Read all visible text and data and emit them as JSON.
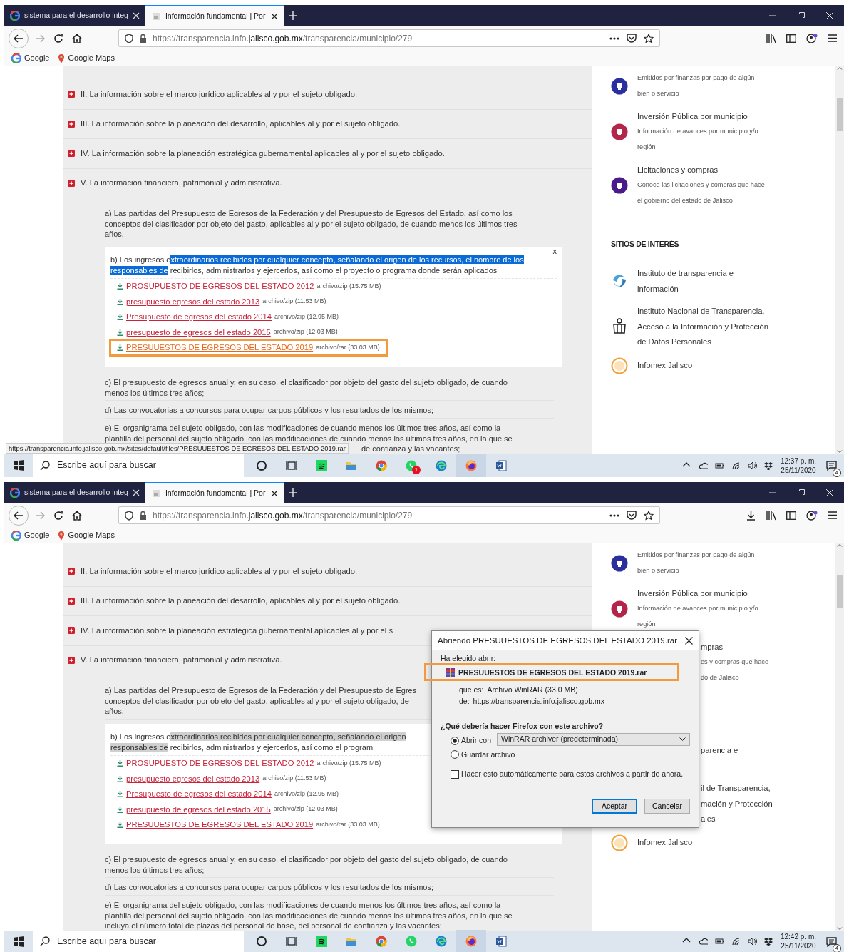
{
  "screens": [
    {
      "tabs": [
        {
          "label": "sistema para el desarrollo integ",
          "selected": false,
          "kind": "google"
        },
        {
          "label": "Información fundamental | Por",
          "selected": true,
          "kind": "site"
        }
      ],
      "url": [
        {
          "text": "https://transparencia.info.",
          "emphasized": false
        },
        {
          "text": "jalisco.gob.mx",
          "emphasized": true
        },
        {
          "text": "/transparencia/municipio/279",
          "emphasized": false
        }
      ],
      "toolbar": [
        {
          "kind": "library"
        },
        {
          "kind": "sidebar"
        },
        {
          "kind": "account"
        },
        {
          "kind": "menu"
        }
      ],
      "bookmarks": [
        {
          "label": "Google",
          "kind": "google"
        },
        {
          "label": "Google Maps",
          "kind": "pin"
        }
      ],
      "sections": [
        "II. La información sobre el marco jurídico aplicables al y por el sujeto obligado.",
        "III. La información sobre la planeación del desarrollo, aplicables al y por el sujeto obligado.",
        "IV. La información sobre la planeación estratégica gubernamental aplicables al y por el sujeto obligado.",
        "V. La información financiera, patrimonial y administrativa."
      ],
      "subsections": [
        {
          "kind": "text",
          "lines": [
            "a) Las partidas del Presupuesto de Egresos de la Federación y del Presupuesto de Egresos del Estado, así como los",
            "conceptos del clasificador por objeto del gasto, aplicables al y por el sujeto obligado, de cuando menos los últimos tres",
            "años."
          ]
        },
        {
          "kind": "files",
          "close": "x",
          "lines": [
            [
              {
                "text": "b) Los ingresos e",
                "selected": false
              },
              {
                "text": "xtraordinarios recibidos por cualquier concepto, señalando el origen de los recursos, el nombre de los",
                "selected": true
              }
            ],
            [
              {
                "text": "responsables de",
                "selected": true
              },
              {
                "text": " recibirlos, administrarlos y ejercerlos, así como el proyecto o programa donde serán aplicados",
                "selected": false
              }
            ]
          ],
          "files": [
            {
              "name": "PROSUPUESTO DE EGRESOS DEL ESTADO 2012",
              "meta": "archivo/zip (15.75 MB)",
              "highlighted": false
            },
            {
              "name": "presupuesto egresos del estado 2013",
              "meta": "archivo/zip (11.53 MB)",
              "highlighted": false
            },
            {
              "name": "Presupuesto de egresos del estado 2014",
              "meta": "archivo/zip (12.95 MB)",
              "highlighted": false
            },
            {
              "name": "presupuesto de egresos del estado 2015",
              "meta": "archivo/zip (12.03 MB)",
              "highlighted": false
            },
            {
              "name": "PRESUUESTOS DE EGRESOS DEL ESTADO 2019",
              "meta": "archivo/rar (33.03 MB)",
              "highlighted": true
            }
          ]
        },
        {
          "kind": "text",
          "lines": [
            "c) El presupuesto de egresos anual y, en su caso, el clasificador por objeto del gasto del sujeto obligado, de cuando",
            "menos los últimos tres años;"
          ]
        },
        {
          "kind": "text",
          "lines": [
            "d) Las convocatorias a concursos para ocupar cargos públicos y los resultados de los mismos;"
          ]
        },
        {
          "kind": "text",
          "status_covered": true,
          "lines": [
            "e) El organigrama del sujeto obligado, con las modificaciones de cuando menos los últimos tres años, así como la",
            "plantilla del personal del sujeto obligado, con las modificaciones de cuando menos los últimos tres años, en la que se",
            "de confianza y las vacantes;"
          ]
        }
      ],
      "sidebar_items": [
        {
          "desc": [
            "Emitidos por finanzas por pago de algún",
            "bien o servicio"
          ],
          "color": "#2b2f9e"
        },
        {
          "title": "Inversión Pública por municipio",
          "desc": [
            "Información de avances por municipio y/o",
            "región"
          ],
          "color": "#b3264a"
        },
        {
          "title": "Licitaciones y compras",
          "desc": [
            "Conoce las licitaciones y compras que hace",
            "el gobierno del estado de Jalisco"
          ],
          "color": "#4a1a8c"
        }
      ],
      "sites_heading": "SITIOS DE INTERÉS",
      "sites": [
        {
          "kind": "swirl",
          "lines": [
            "Instituto de transparencia e",
            "información"
          ]
        },
        {
          "kind": "reader",
          "lines": [
            "Instituto Nacional de Transparencia,",
            "Acceso a la Información y Protección",
            "de Datos Personales"
          ]
        },
        {
          "kind": "infomex",
          "lines": [
            "Infomex Jalisco"
          ]
        }
      ],
      "status_url": "https://transparencia.info.jalisco.gob.mx/sites/default/files/PRESUUESTOS DE EGRESOS DEL ESTADO 2019.rar",
      "taskbar": {
        "search": "Escribe aquí para buscar",
        "apps": [
          {
            "kind": "cortana",
            "active": false
          },
          {
            "kind": "taskview",
            "active": false
          },
          {
            "kind": "music",
            "active": false
          },
          {
            "kind": "folder",
            "active": false
          },
          {
            "kind": "chrome",
            "active": false
          },
          {
            "kind": "chat",
            "active": false,
            "badge": "1"
          },
          {
            "kind": "edge",
            "active": false
          },
          {
            "kind": "fox",
            "active": true
          },
          {
            "kind": "doc",
            "active": false
          }
        ],
        "time": "12:37 p. m.",
        "date": "25/11/2020",
        "notifications": "4"
      }
    },
    {
      "tabs": [
        {
          "label": "sistema para el desarrollo integ",
          "selected": false,
          "kind": "google"
        },
        {
          "label": "Información fundamental | Por",
          "selected": true,
          "kind": "site"
        }
      ],
      "url": [
        {
          "text": "https://transparencia.info.",
          "emphasized": false
        },
        {
          "text": "jalisco.gob.mx",
          "emphasized": true
        },
        {
          "text": "/transparencia/municipio/279",
          "emphasized": false
        }
      ],
      "toolbar": [
        {
          "kind": "download"
        },
        {
          "kind": "library"
        },
        {
          "kind": "sidebar"
        },
        {
          "kind": "account"
        },
        {
          "kind": "menu"
        }
      ],
      "bookmarks": [
        {
          "label": "Google",
          "kind": "google"
        },
        {
          "label": "Google Maps",
          "kind": "pin"
        }
      ],
      "sections": [
        "II. La información sobre el marco jurídico aplicables al y por el sujeto obligado.",
        "III. La información sobre la planeación del desarrollo, aplicables al y por el sujeto obligado.",
        "IV. La información sobre la planeación estratégica gubernamental aplicables al y por el s",
        "V. La información financiera, patrimonial y administrativa."
      ],
      "subsections": [
        {
          "kind": "text",
          "lines": [
            "a) Las partidas del Presupuesto de Egresos de la Federación y del Presupuesto de Egres",
            "conceptos del clasificador por objeto del gasto, aplicables al y por el sujeto obligado, de",
            "años."
          ]
        },
        {
          "kind": "files",
          "lines": [
            [
              {
                "text": "b) Los ingresos e",
                "selected": false
              },
              {
                "text": "xtraordinarios recibidos por cualquier concepto, señalando el origen",
                "selected": true
              }
            ],
            [
              {
                "text": "responsables de",
                "selected": true
              },
              {
                "text": " recibirlos, administrarlos y ejercerlos, así como el program",
                "selected": false
              }
            ]
          ],
          "files": [
            {
              "name": "PROSUPUESTO DE EGRESOS DEL ESTADO 2012",
              "meta": "archivo/zip (15.75 MB)",
              "highlighted": false
            },
            {
              "name": "presupuesto egresos del estado 2013",
              "meta": "archivo/zip (11.53 MB)",
              "highlighted": false
            },
            {
              "name": "Presupuesto de egresos del estado 2014",
              "meta": "archivo/zip (12.95 MB)",
              "highlighted": false
            },
            {
              "name": "presupuesto de egresos del estado 2015",
              "meta": "archivo/zip (12.03 MB)",
              "highlighted": false
            },
            {
              "name": "PRESUUESTOS DE EGRESOS DEL ESTADO 2019",
              "meta": "archivo/rar (33.03 MB)",
              "highlighted": false
            }
          ]
        },
        {
          "kind": "text",
          "lines": [
            "c) El presupuesto de egresos anual y, en su caso, el clasificador por objeto del gasto del sujeto obligado, de cuando",
            "menos los últimos tres años;"
          ]
        },
        {
          "kind": "text",
          "lines": [
            "d) Las convocatorias a concursos para ocupar cargos públicos y los resultados de los mismos;"
          ]
        },
        {
          "kind": "text",
          "status_covered": false,
          "lines": [
            "e) El organigrama del sujeto obligado, con las modificaciones de cuando menos los últimos tres años, así como la",
            "plantilla del personal del sujeto obligado, con las modificaciones de cuando menos los últimos tres años, en la que se",
            "incluya el número total de plazas del personal de base, del personal de confianza y las vacantes;"
          ]
        }
      ],
      "sidebar_items": [
        {
          "desc": [
            "Emitidos por finanzas por pago de algún",
            "bien o servicio"
          ],
          "color": "#2b2f9e"
        },
        {
          "title": "Inversión Pública por municipio",
          "desc": [
            "Información de avances por municipio y/o",
            "región"
          ],
          "color": "#b3264a"
        },
        {
          "title": "mpras",
          "desc": [
            "es y compras que hace",
            "do de Jalisco"
          ]
        }
      ],
      "sites": [
        {
          "lines": [
            "parencia e"
          ]
        },
        {
          "lines": [
            "il de Transparencia,",
            "mación y Protección",
            "ales"
          ]
        },
        {
          "kind": "infomex",
          "lines": [
            "Infomex Jalisco"
          ]
        }
      ],
      "dialog": {
        "title": "Abriendo PRESUUESTOS DE EGRESOS DEL ESTADO 2019.rar",
        "intro": "Ha elegido abrir:",
        "file": "PRESUUESTOS DE EGRESOS DEL ESTADO 2019.rar",
        "highlighted": true,
        "type_label": "que es:",
        "type": "Archivo WinRAR (33.0 MB)",
        "from_label": "de:",
        "from": "https://transparencia.info.jalisco.gob.mx",
        "question": "¿Qué debería hacer Firefox con este archivo?",
        "options": [
          {
            "label": "Abrir con",
            "selected": true
          },
          {
            "label": "Guardar archivo",
            "selected": false
          }
        ],
        "app": "WinRAR archiver (predeterminada)",
        "auto": {
          "label": "Hacer esto automáticamente para estos archivos a partir de ahora.",
          "checked": false
        },
        "buttons": [
          {
            "label": "Aceptar",
            "default": true
          },
          {
            "label": "Cancelar",
            "default": false
          }
        ]
      },
      "taskbar": {
        "search": "Escribe aquí para buscar",
        "apps": [
          {
            "kind": "cortana",
            "active": false
          },
          {
            "kind": "taskview",
            "active": false
          },
          {
            "kind": "music",
            "active": false
          },
          {
            "kind": "folder",
            "active": false
          },
          {
            "kind": "chrome",
            "active": false
          },
          {
            "kind": "chat",
            "active": false
          },
          {
            "kind": "edge",
            "active": false
          },
          {
            "kind": "fox",
            "active": true
          },
          {
            "kind": "doc",
            "active": false
          }
        ],
        "time": "12:42 p. m.",
        "date": "25/11/2020",
        "notifications": "4"
      }
    }
  ]
}
